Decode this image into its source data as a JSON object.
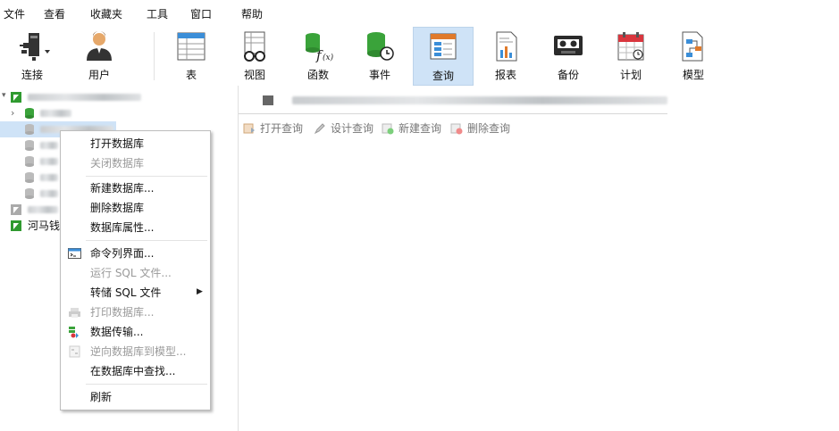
{
  "menu": {
    "items": [
      "文件",
      "查看",
      "收藏夹",
      "工具",
      "窗口",
      "帮助"
    ]
  },
  "toolbar": {
    "buttons": [
      {
        "label": "连接",
        "icon": "connection-icon"
      },
      {
        "label": "用户",
        "icon": "user-icon"
      },
      {
        "label": "表",
        "icon": "table-icon"
      },
      {
        "label": "视图",
        "icon": "view-icon"
      },
      {
        "label": "函数",
        "icon": "function-icon"
      },
      {
        "label": "事件",
        "icon": "event-icon"
      },
      {
        "label": "查询",
        "icon": "query-icon",
        "active": true
      },
      {
        "label": "报表",
        "icon": "report-icon"
      },
      {
        "label": "备份",
        "icon": "backup-icon"
      },
      {
        "label": "计划",
        "icon": "schedule-icon"
      },
      {
        "label": "模型",
        "icon": "model-icon"
      }
    ]
  },
  "tree": {
    "visible_node": "河马钱"
  },
  "query_toolbar": {
    "open": "打开查询",
    "design": "设计查询",
    "new": "新建查询",
    "delete": "删除查询"
  },
  "context_menu": {
    "items": [
      {
        "label": "打开数据库",
        "disabled": false
      },
      {
        "label": "关闭数据库",
        "disabled": true
      },
      {
        "label": "新建数据库...",
        "disabled": false
      },
      {
        "label": "删除数据库",
        "disabled": false
      },
      {
        "label": "数据库属性...",
        "disabled": false
      },
      {
        "label": "命令列界面...",
        "disabled": false
      },
      {
        "label": "运行 SQL 文件...",
        "disabled": true
      },
      {
        "label": "转储 SQL 文件",
        "disabled": false,
        "submenu": true
      },
      {
        "label": "打印数据库...",
        "disabled": true
      },
      {
        "label": "数据传输...",
        "disabled": false
      },
      {
        "label": "逆向数据库到模型...",
        "disabled": true
      },
      {
        "label": "在数据库中查找...",
        "disabled": false
      },
      {
        "label": "刷新",
        "disabled": false
      }
    ]
  },
  "colors": {
    "selection": "#cfe3f7",
    "db_green": "#3aa33a",
    "accent_red": "#d9363e"
  }
}
